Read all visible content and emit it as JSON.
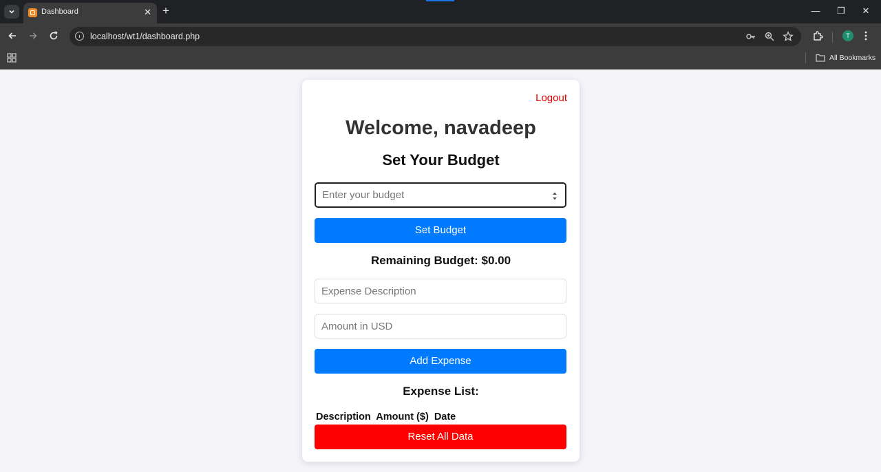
{
  "browser": {
    "tab_title": "Dashboard",
    "tab_close": "✕",
    "new_tab": "+",
    "url": "localhost/wt1/dashboard.php",
    "avatar_initial": "T",
    "bookmarks_label": "All Bookmarks",
    "window_controls": {
      "minimize": "—",
      "maximize": "❐",
      "close": "✕"
    }
  },
  "page": {
    "logout": "Logout",
    "welcome": "Welcome, navadeep",
    "budget_heading": "Set Your Budget",
    "budget_placeholder": "Enter your budget",
    "set_budget_button": "Set Budget",
    "remaining_budget": "Remaining Budget: $0.00",
    "expense_description_placeholder": "Expense Description",
    "amount_placeholder": "Amount in USD",
    "add_expense_button": "Add Expense",
    "expense_list_heading": "Expense List:",
    "columns": [
      "Description",
      "Amount ($)",
      "Date"
    ],
    "reset_button": "Reset All Data"
  },
  "colors": {
    "primary": "#007bff",
    "danger": "#ff0000",
    "logout": "#e00000",
    "page_background": "#f4f4f9"
  }
}
